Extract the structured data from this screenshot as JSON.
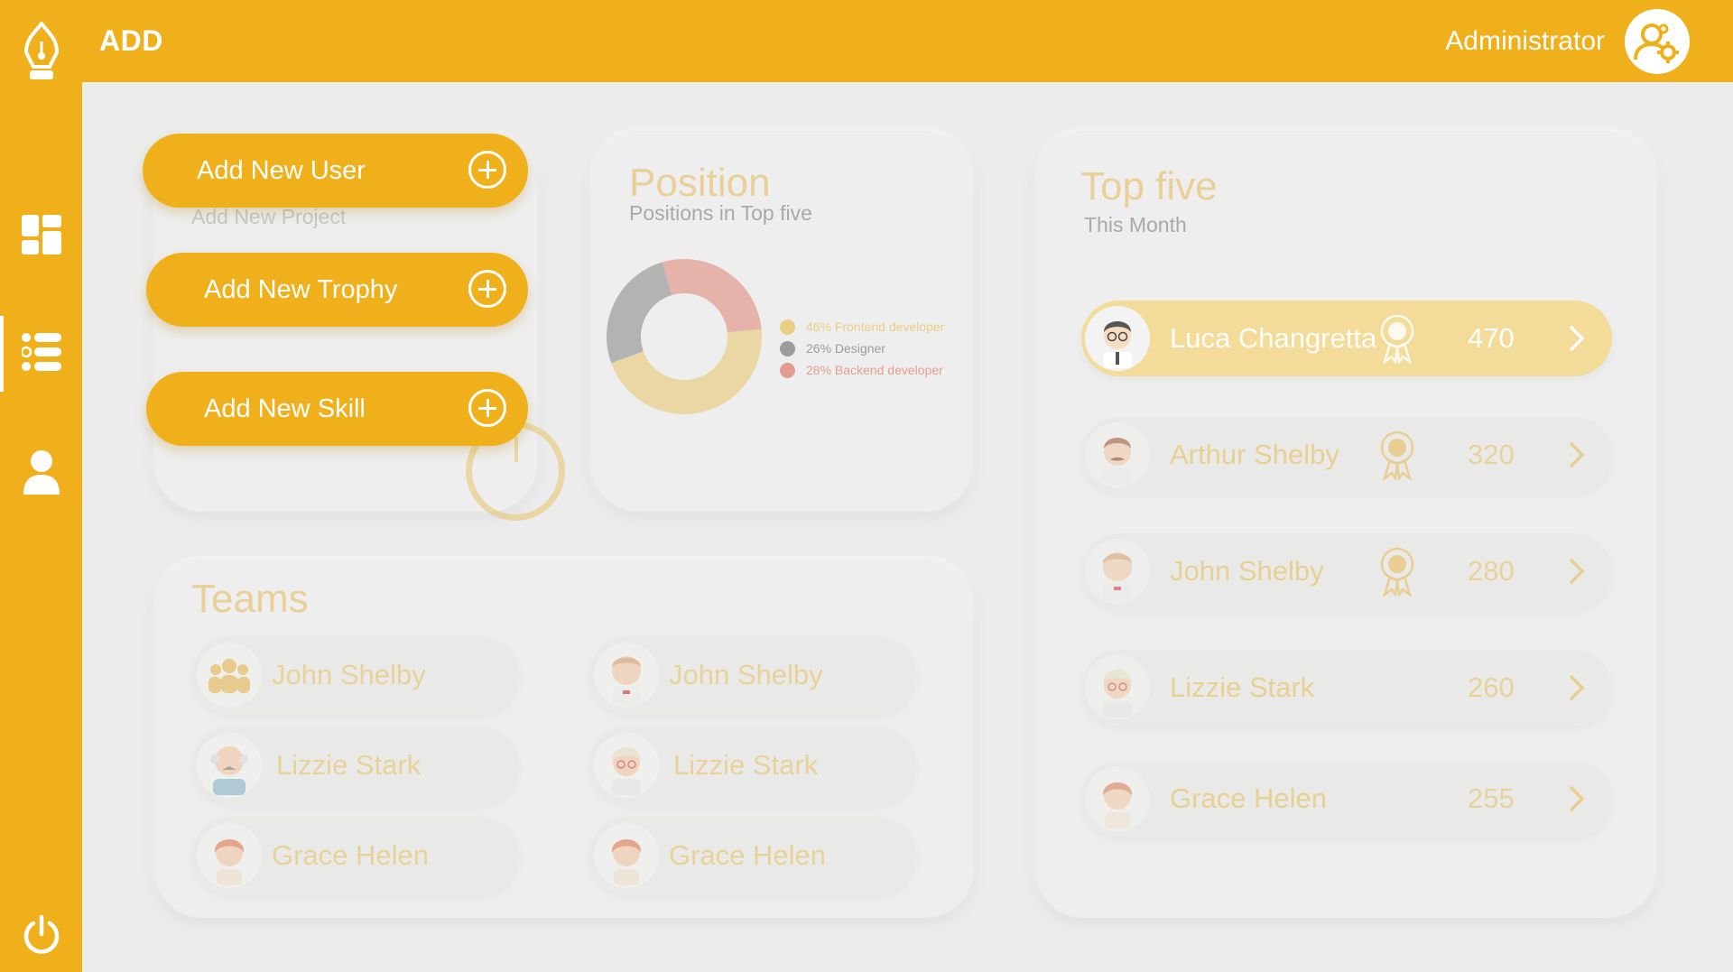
{
  "app": {
    "page_title": "ADD",
    "user_name": "Administrator",
    "accent_color": "#f0b01c"
  },
  "sidebar": {
    "items": [
      {
        "name": "logo-icon",
        "icon": "pen-nib"
      },
      {
        "name": "dashboard-icon",
        "icon": "grid"
      },
      {
        "name": "list-icon",
        "icon": "list",
        "active": true
      },
      {
        "name": "user-icon",
        "icon": "person"
      },
      {
        "name": "power-icon",
        "icon": "power"
      }
    ]
  },
  "add_panel": {
    "buttons": [
      {
        "label": "Add New User"
      },
      {
        "label": "Add New Trophy"
      },
      {
        "label": "Add New Skill"
      }
    ],
    "behind_label": "Add New Project"
  },
  "position_card": {
    "title": "Position",
    "subtitle": "Positions in Top five",
    "legend": [
      {
        "label": "46% Frontend developer",
        "color": "#e8c15a"
      },
      {
        "label": "26% Designer",
        "color": "#7a7a7a"
      },
      {
        "label": "28% Backend developer",
        "color": "#e07a6a"
      }
    ]
  },
  "chart_data": {
    "type": "pie",
    "title": "Position",
    "categories": [
      "Frontend developer",
      "Designer",
      "Backend developer"
    ],
    "values": [
      46,
      26,
      28
    ]
  },
  "teams_card": {
    "title": "Teams",
    "members": [
      {
        "name": "John Shelby",
        "avatar": "group"
      },
      {
        "name": "John Shelby",
        "avatar": "boy"
      },
      {
        "name": "Lizzie Stark",
        "avatar": "old-man"
      },
      {
        "name": "Lizzie Stark",
        "avatar": "old-woman"
      },
      {
        "name": "Grace Helen",
        "avatar": "redhead"
      },
      {
        "name": "Grace Helen",
        "avatar": "redhead"
      }
    ]
  },
  "top_five": {
    "title": "Top five",
    "subtitle": "This Month",
    "rows": [
      {
        "name": "Luca Changretta",
        "score": "470",
        "avatar": "man-glasses",
        "medal": true
      },
      {
        "name": "Arthur Shelby",
        "score": "320",
        "avatar": "mustache",
        "medal": true
      },
      {
        "name": "John Shelby",
        "score": "280",
        "avatar": "boy",
        "medal": true
      },
      {
        "name": "Lizzie Stark",
        "score": "260",
        "avatar": "old-woman",
        "medal": false
      },
      {
        "name": "Grace Helen",
        "score": "255",
        "avatar": "redhead",
        "medal": false
      }
    ]
  }
}
